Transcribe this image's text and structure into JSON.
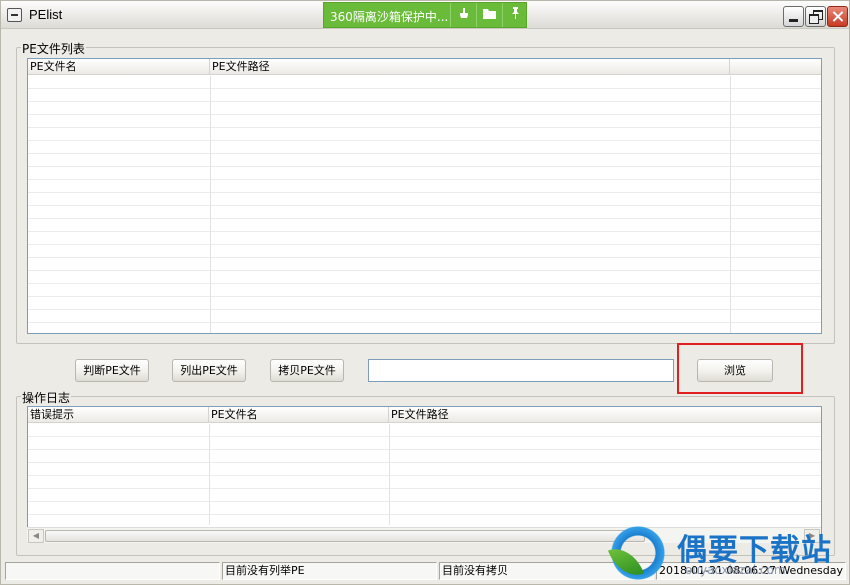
{
  "window": {
    "title": "PElist",
    "sandbox_banner": {
      "text": "360隔离沙箱保护中...",
      "icons": [
        "broom-icon",
        "folder-icon",
        "pin-icon"
      ]
    }
  },
  "pe_list_group": {
    "label": "PE文件列表",
    "columns": [
      "PE文件名",
      "PE文件路径",
      ""
    ],
    "rows": []
  },
  "actions": {
    "judge_button": "判断PE文件",
    "list_button": "列出PE文件",
    "copy_button": "拷贝PE文件",
    "path_value": "",
    "browse_button": "浏览"
  },
  "log_group": {
    "label": "操作日志",
    "columns": [
      "错误提示",
      "PE文件名",
      "PE文件路径"
    ],
    "rows": []
  },
  "statusbar": {
    "cell1": "",
    "cell2": "目前没有列举PE",
    "cell3": "目前没有拷贝",
    "cell4": "2018-01-31 08:06:27 Wednesday"
  },
  "watermark": {
    "title": "偶要下载站",
    "url": "ouyaoxiazai.com"
  },
  "colors": {
    "sandbox_green": "#6bbb3a",
    "highlight_red": "#e02020",
    "watermark_blue": "#1a73c6"
  }
}
